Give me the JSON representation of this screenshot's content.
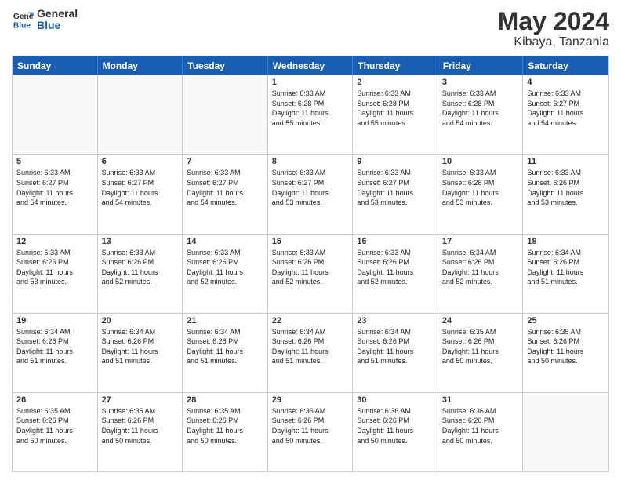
{
  "logo": {
    "line1": "General",
    "line2": "Blue"
  },
  "title": "May 2024",
  "location": "Kibaya, Tanzania",
  "weekdays": [
    "Sunday",
    "Monday",
    "Tuesday",
    "Wednesday",
    "Thursday",
    "Friday",
    "Saturday"
  ],
  "weeks": [
    [
      {
        "day": "",
        "info": ""
      },
      {
        "day": "",
        "info": ""
      },
      {
        "day": "",
        "info": ""
      },
      {
        "day": "1",
        "info": "Sunrise: 6:33 AM\nSunset: 6:28 PM\nDaylight: 11 hours\nand 55 minutes."
      },
      {
        "day": "2",
        "info": "Sunrise: 6:33 AM\nSunset: 6:28 PM\nDaylight: 11 hours\nand 55 minutes."
      },
      {
        "day": "3",
        "info": "Sunrise: 6:33 AM\nSunset: 6:28 PM\nDaylight: 11 hours\nand 54 minutes."
      },
      {
        "day": "4",
        "info": "Sunrise: 6:33 AM\nSunset: 6:27 PM\nDaylight: 11 hours\nand 54 minutes."
      }
    ],
    [
      {
        "day": "5",
        "info": "Sunrise: 6:33 AM\nSunset: 6:27 PM\nDaylight: 11 hours\nand 54 minutes."
      },
      {
        "day": "6",
        "info": "Sunrise: 6:33 AM\nSunset: 6:27 PM\nDaylight: 11 hours\nand 54 minutes."
      },
      {
        "day": "7",
        "info": "Sunrise: 6:33 AM\nSunset: 6:27 PM\nDaylight: 11 hours\nand 54 minutes."
      },
      {
        "day": "8",
        "info": "Sunrise: 6:33 AM\nSunset: 6:27 PM\nDaylight: 11 hours\nand 53 minutes."
      },
      {
        "day": "9",
        "info": "Sunrise: 6:33 AM\nSunset: 6:27 PM\nDaylight: 11 hours\nand 53 minutes."
      },
      {
        "day": "10",
        "info": "Sunrise: 6:33 AM\nSunset: 6:26 PM\nDaylight: 11 hours\nand 53 minutes."
      },
      {
        "day": "11",
        "info": "Sunrise: 6:33 AM\nSunset: 6:26 PM\nDaylight: 11 hours\nand 53 minutes."
      }
    ],
    [
      {
        "day": "12",
        "info": "Sunrise: 6:33 AM\nSunset: 6:26 PM\nDaylight: 11 hours\nand 53 minutes."
      },
      {
        "day": "13",
        "info": "Sunrise: 6:33 AM\nSunset: 6:26 PM\nDaylight: 11 hours\nand 52 minutes."
      },
      {
        "day": "14",
        "info": "Sunrise: 6:33 AM\nSunset: 6:26 PM\nDaylight: 11 hours\nand 52 minutes."
      },
      {
        "day": "15",
        "info": "Sunrise: 6:33 AM\nSunset: 6:26 PM\nDaylight: 11 hours\nand 52 minutes."
      },
      {
        "day": "16",
        "info": "Sunrise: 6:33 AM\nSunset: 6:26 PM\nDaylight: 11 hours\nand 52 minutes."
      },
      {
        "day": "17",
        "info": "Sunrise: 6:34 AM\nSunset: 6:26 PM\nDaylight: 11 hours\nand 52 minutes."
      },
      {
        "day": "18",
        "info": "Sunrise: 6:34 AM\nSunset: 6:26 PM\nDaylight: 11 hours\nand 51 minutes."
      }
    ],
    [
      {
        "day": "19",
        "info": "Sunrise: 6:34 AM\nSunset: 6:26 PM\nDaylight: 11 hours\nand 51 minutes."
      },
      {
        "day": "20",
        "info": "Sunrise: 6:34 AM\nSunset: 6:26 PM\nDaylight: 11 hours\nand 51 minutes."
      },
      {
        "day": "21",
        "info": "Sunrise: 6:34 AM\nSunset: 6:26 PM\nDaylight: 11 hours\nand 51 minutes."
      },
      {
        "day": "22",
        "info": "Sunrise: 6:34 AM\nSunset: 6:26 PM\nDaylight: 11 hours\nand 51 minutes."
      },
      {
        "day": "23",
        "info": "Sunrise: 6:34 AM\nSunset: 6:26 PM\nDaylight: 11 hours\nand 51 minutes."
      },
      {
        "day": "24",
        "info": "Sunrise: 6:35 AM\nSunset: 6:26 PM\nDaylight: 11 hours\nand 50 minutes."
      },
      {
        "day": "25",
        "info": "Sunrise: 6:35 AM\nSunset: 6:26 PM\nDaylight: 11 hours\nand 50 minutes."
      }
    ],
    [
      {
        "day": "26",
        "info": "Sunrise: 6:35 AM\nSunset: 6:26 PM\nDaylight: 11 hours\nand 50 minutes."
      },
      {
        "day": "27",
        "info": "Sunrise: 6:35 AM\nSunset: 6:26 PM\nDaylight: 11 hours\nand 50 minutes."
      },
      {
        "day": "28",
        "info": "Sunrise: 6:35 AM\nSunset: 6:26 PM\nDaylight: 11 hours\nand 50 minutes."
      },
      {
        "day": "29",
        "info": "Sunrise: 6:36 AM\nSunset: 6:26 PM\nDaylight: 11 hours\nand 50 minutes."
      },
      {
        "day": "30",
        "info": "Sunrise: 6:36 AM\nSunset: 6:26 PM\nDaylight: 11 hours\nand 50 minutes."
      },
      {
        "day": "31",
        "info": "Sunrise: 6:36 AM\nSunset: 6:26 PM\nDaylight: 11 hours\nand 50 minutes."
      },
      {
        "day": "",
        "info": ""
      }
    ]
  ]
}
